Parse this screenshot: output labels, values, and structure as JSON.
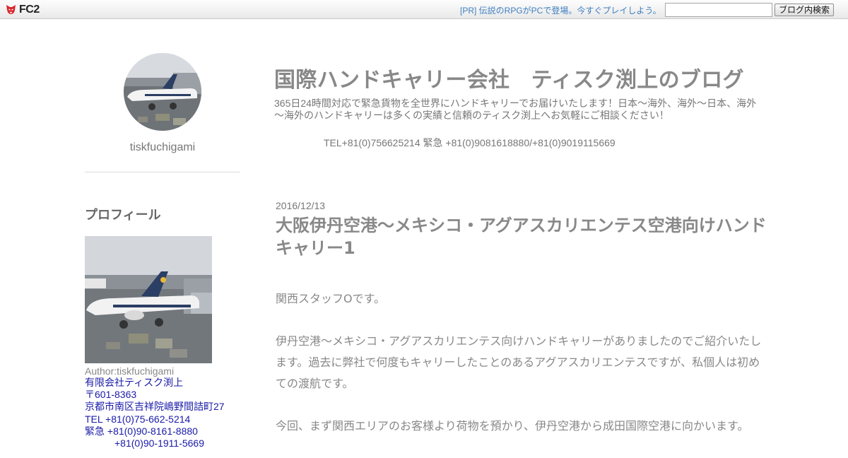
{
  "topbar": {
    "logo_text": "FC2",
    "pr_text": "[PR] 伝説のRPGがPCで登場。今すぐプレイしよう。",
    "search_value": "",
    "search_button": "ブログ内検索"
  },
  "sidebar": {
    "username": "tiskfuchigami",
    "profile_heading": "プロフィール",
    "author": "Author:tiskfuchigami",
    "contact_lines": "有限会社ティスク渕上\n〒601-8363\n京都市南区吉祥院嶋野間詰町27\nTEL +81(0)75-662-5214\n緊急 +81(0)90-8161-8880\n　　　+81(0)90-1911-5669"
  },
  "blog": {
    "title": "国際ハンドキャリー会社　ティスク渕上のブログ",
    "description": "365日24時間対応で緊急貨物を全世界にハンドキャリーでお届けいたします！日本～海外、海外～日本、海外～海外のハンドキャリーは多くの実績と信頼のティスク渕上へお気軽にご相談ください！",
    "tel": "TEL+81(0)756625214 緊急 +81(0)9081618880/+81(0)9019115669"
  },
  "post": {
    "date": "2016/12/13",
    "title": "大阪伊丹空港～メキシコ・アグアスカリエンテス空港向けハンドキャリー1",
    "paragraphs": [
      "関西スタッフOです。",
      "伊丹空港〜メキシコ・アグアスカリエンテス向けハンドキャリーがありましたのでご紹介いたします。過去に弊社で何度もキャリーしたことのあるアグアスカリエンテスですが、私個人は初めての渡航です。",
      "今回、まず関西エリアのお客様より荷物を預かり、伊丹空港から成田国際空港に向かいます。"
    ]
  },
  "colors": {
    "title_gray": "#888888",
    "link_blue": "#3f7fc0",
    "contact_blue": "#1a1aa8",
    "fc2_red": "#d9262c"
  }
}
